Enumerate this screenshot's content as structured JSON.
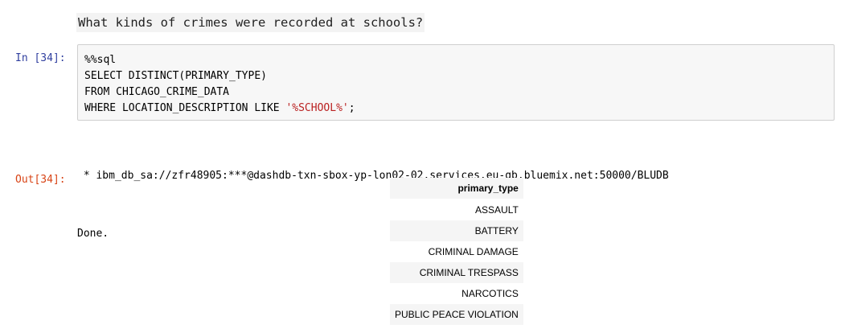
{
  "markdown": {
    "text": "What kinds of crimes were recorded at schools?"
  },
  "input_cell": {
    "prompt": "In [34]:",
    "lines": [
      "%%sql",
      "SELECT DISTINCT(PRIMARY_TYPE)",
      "FROM CHICAGO_CRIME_DATA",
      "WHERE LOCATION_DESCRIPTION LIKE "
    ],
    "string_literal": "'%SCHOOL%'",
    "terminator": ";"
  },
  "stdout": {
    "connection": " * ibm_db_sa://zfr48905:***@dashdb-txn-sbox-yp-lon02-02.services.eu-gb.bluemix.net:50000/BLUDB",
    "status": "Done."
  },
  "output_cell": {
    "prompt": "Out[34]:",
    "table": {
      "header": "primary_type",
      "rows": [
        "ASSAULT",
        "BATTERY",
        "CRIMINAL DAMAGE",
        "CRIMINAL TRESPASS",
        "NARCOTICS",
        "PUBLIC PEACE VIOLATION"
      ]
    }
  }
}
